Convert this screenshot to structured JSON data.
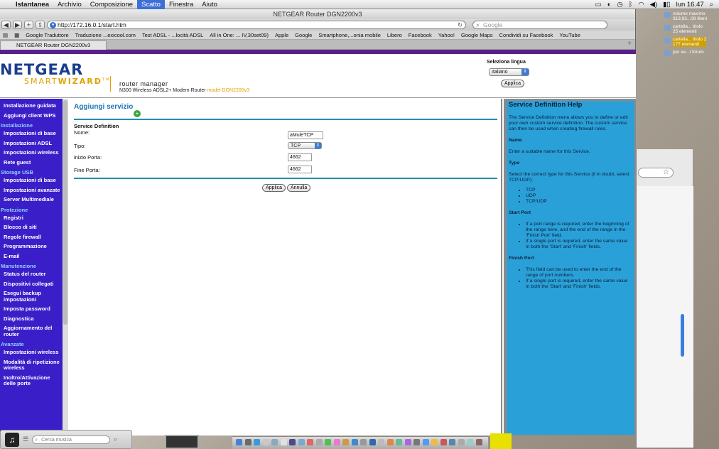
{
  "menubar": {
    "apple": "",
    "items": [
      "Istantanea",
      "Archivio",
      "Composizione",
      "Scatto",
      "Finestra",
      "Aiuto"
    ],
    "clock": "lun 16.47"
  },
  "desktop": {
    "icons": [
      {
        "name": "volume maximo",
        "sub": "313,93...08 liberi"
      },
      {
        "name": "cartella... titolo",
        "sub": "25 elementi"
      },
      {
        "name": "cartella... titolo 2",
        "sub": "177 elementi"
      },
      {
        "name": "per ve...t forum",
        "sub": ""
      }
    ]
  },
  "browser": {
    "window_title": "NETGEAR Router DGN2200v3",
    "url": "http://172.16.0.1/start.htm",
    "search_placeholder": "Google",
    "bookmarks": [
      "Google Traduttore",
      "Traduzione ...exicool.com",
      "Test ADSL - ...locità ADSL",
      "All in One: ... IV,30set09)",
      "Apple",
      "Google",
      "Smartphone,...onia mobile",
      "Libero",
      "Facebook",
      "Yahoo!",
      "Google Maps",
      "Condividi su Facebook",
      "YouTube"
    ],
    "tab_title": "NETGEAR Router DGN2200v3"
  },
  "header": {
    "logo_top": "NETGEAR",
    "logo_bottom_a": "SMART",
    "logo_bottom_b": "WIZARD",
    "tm": "TM",
    "rm_label": "router manager",
    "model_desc": "N300 Wireless ADSL2+ Modem Router",
    "model_name": "model DGN2200v3",
    "lang_label": "Seleziona lingua",
    "lang_value": "Italiano",
    "lang_apply": "Applica"
  },
  "sidebar": {
    "items": [
      {
        "t": "Installazione guidata",
        "g": false
      },
      {
        "t": "Aggiungi client WPS",
        "g": false
      },
      {
        "t": "Installazione",
        "g": true
      },
      {
        "t": "Impostazioni di base",
        "g": false
      },
      {
        "t": "Impostazioni ADSL",
        "g": false
      },
      {
        "t": "Impostazioni wireless",
        "g": false
      },
      {
        "t": "Rete guest",
        "g": false
      },
      {
        "t": "Storage USB",
        "g": true
      },
      {
        "t": "Impostazioni di base",
        "g": false
      },
      {
        "t": "Impostazioni avanzate",
        "g": false
      },
      {
        "t": "Server Multimediale",
        "g": false
      },
      {
        "t": "Protezione",
        "g": true
      },
      {
        "t": "Registri",
        "g": false
      },
      {
        "t": "Blocco di siti",
        "g": false
      },
      {
        "t": "Regole firewall",
        "g": false
      },
      {
        "t": "Programmazione",
        "g": false
      },
      {
        "t": "E-mail",
        "g": false
      },
      {
        "t": "Manutenzione",
        "g": true
      },
      {
        "t": "Status del router",
        "g": false
      },
      {
        "t": "Dispositivi collegati",
        "g": false
      },
      {
        "t": "Esegui backup impostazioni",
        "g": false
      },
      {
        "t": "Imposta password",
        "g": false
      },
      {
        "t": "Diagnostica",
        "g": false
      },
      {
        "t": "Aggiornamento del router",
        "g": false
      },
      {
        "t": "Avanzate",
        "g": true
      },
      {
        "t": "Impostazioni wireless",
        "g": false
      },
      {
        "t": "Modalità di ripetizione wireless",
        "g": false
      },
      {
        "t": "Inoltro/Attivazione delle porte",
        "g": false
      }
    ]
  },
  "form": {
    "title": "Aggiungi servizio",
    "section": "Service Definition",
    "name_label": "Nome:",
    "name_value": "aMuleTCP",
    "type_label": "Tipo:",
    "type_value": "TCP",
    "start_label": "inizio Porta:",
    "start_value": "4662",
    "end_label": "Fine Porta:",
    "end_value": "4662",
    "apply": "Applica",
    "cancel": "Annulla"
  },
  "help": {
    "title": "Service Definition Help",
    "intro": "The Service Definition menu allows you to define or edit your own custom service definition. The custom service can then be used when creating firewall rules.",
    "name_h": "Name",
    "name_t": "Enter a suitable name for this Service.",
    "type_h": "Type",
    "type_t": "Select the correct type for this Service (if in doubt, select TCP/UDP):",
    "type_opts": [
      "TCP",
      "UDP",
      "TCP/UDP"
    ],
    "start_h": "Start Port",
    "start_opts": [
      "If a port range is required, enter the beginning of the range here, and the end of the range in the 'Finish Port' field.",
      "If a single port is required, enter the same value in both the 'Start' and 'Finish' fields."
    ],
    "finish_h": "Finish Port",
    "finish_opts": [
      "This field can be used to enter the end of the range of port numbers.",
      "If a single port is required, enter the same value in both the 'Start' and 'Finish' fields."
    ]
  },
  "itunes": {
    "search_placeholder": "Cerca musica"
  }
}
